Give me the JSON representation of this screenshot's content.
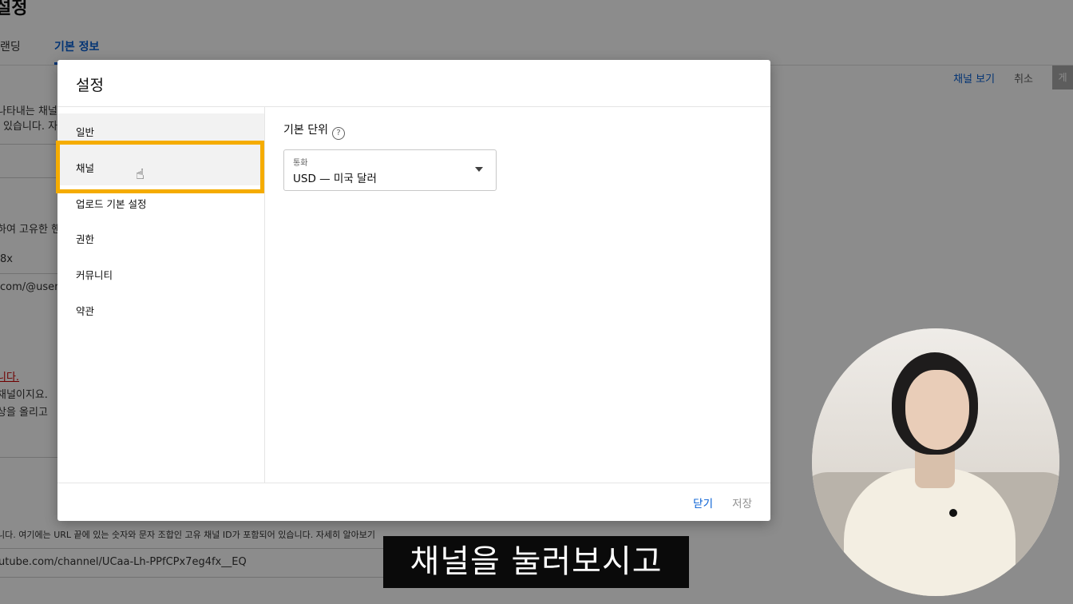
{
  "background": {
    "page_title": "설정",
    "tabs": [
      {
        "label": "랜딩"
      },
      {
        "label": "기본 정보"
      }
    ],
    "actions": {
      "view_channel": "채널 보기",
      "cancel": "취소",
      "publish": "게"
    },
    "lines": [
      "나타내는 채널",
      "있습니다. 자",
      "하여 고유한 핸",
      "8x",
      "com/@user-",
      "니다.",
      "채널이지요.",
      "상을 올리고",
      "니다. 여기에는 URL 끝에 있는 숫자와 문자 조합인 고유 채널 ID가 포함되어 있습니다. 자세히 알아보기",
      "utube.com/channel/UCaa-Lh-PPfCPx7eg4fx__EQ"
    ]
  },
  "dialog": {
    "title": "설정",
    "sidebar": [
      {
        "label": "일반"
      },
      {
        "label": "채널"
      },
      {
        "label": "업로드 기본 설정"
      },
      {
        "label": "권한"
      },
      {
        "label": "커뮤니티"
      },
      {
        "label": "약관"
      }
    ],
    "selected_index": 1,
    "content": {
      "section_label": "기본 단위",
      "help_icon": "?",
      "currency": {
        "label": "통화",
        "value": "USD — 미국 달러"
      }
    },
    "footer": {
      "close": "닫기",
      "save": "저장"
    }
  },
  "subtitle": "채널을 눌러보시고",
  "colors": {
    "accent": "#065fd4",
    "highlight": "#f5ac00"
  }
}
